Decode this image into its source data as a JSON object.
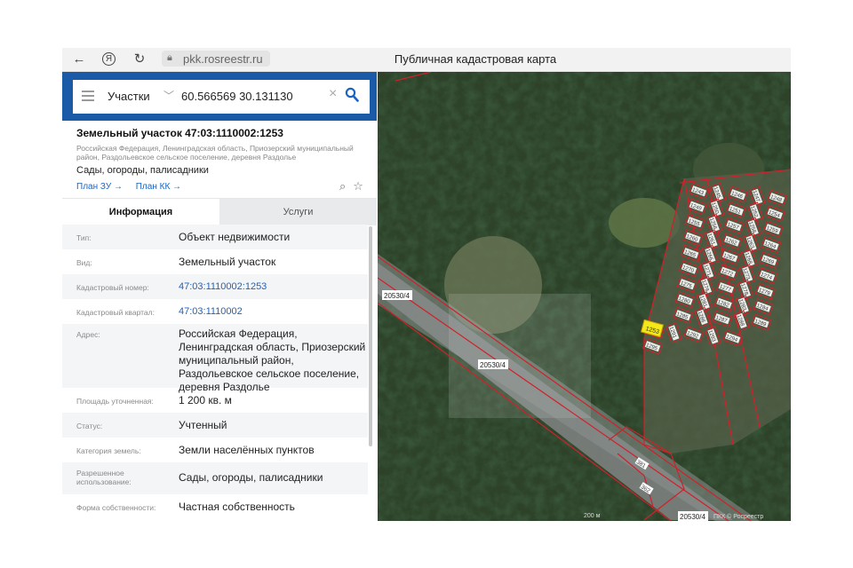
{
  "browser": {
    "url": "pkk.rosreestr.ru",
    "title": "Публичная кадастровая карта"
  },
  "search": {
    "type": "Участки",
    "query": "60.566569 30.131130"
  },
  "parcel": {
    "title": "Земельный участок 47:03:1110002:1253",
    "address_short": "Российская Федерация, Ленинградская область, Приозерский муниципальный район, Раздольевское сельское поселение, деревня Раздолье",
    "use": "Сады, огороды, палисадники",
    "link_plan_zu": "План ЗУ →",
    "link_plan_kk": "План КК →"
  },
  "tabs": [
    "Информация",
    "Услуги"
  ],
  "fields": [
    {
      "label": "Тип:",
      "value": "Объект недвижимости"
    },
    {
      "label": "Вид:",
      "value": "Земельный участок"
    },
    {
      "label": "Кадастровый номер:",
      "value": "47:03:1110002:1253",
      "link": true
    },
    {
      "label": "Кадастровый квартал:",
      "value": "47:03:1110002",
      "link": true
    },
    {
      "label": "Адрес:",
      "value": "Российская Федерация, Ленинградская область, Приозерский муниципальный район, Раздольевское сельское поселение, деревня Раздолье"
    },
    {
      "label": "Площадь уточненная:",
      "value": "1 200 кв. м"
    },
    {
      "label": "Статус:",
      "value": "Учтенный"
    },
    {
      "label": "Категория земель:",
      "value": "Земли населённых пунктов"
    },
    {
      "label": "Разрешенное использование:",
      "value": "Сады, огороды, палисадники"
    },
    {
      "label": "Форма собственности:",
      "value": "Частная собственность"
    }
  ],
  "map": {
    "road_labels": [
      "20530/4",
      "20530/4",
      "20530/4"
    ],
    "parcel_labels": [
      "1243",
      "1245",
      "1246",
      "1247",
      "1248",
      "1249",
      "1250",
      "1251",
      "1252",
      "1253",
      "1254",
      "1255",
      "1256",
      "1257",
      "1258",
      "1259",
      "1260",
      "1261",
      "1262",
      "1263",
      "1264",
      "1265",
      "1266",
      "1267",
      "1268",
      "1269",
      "1270",
      "1271",
      "1272",
      "1273",
      "1274",
      "1275",
      "1276",
      "1277",
      "1278",
      "1279",
      "1280",
      "1281",
      "1282",
      "1283",
      "1284",
      "1285",
      "1286",
      "1287",
      "1288",
      "1289",
      "1290",
      "1291",
      "1292",
      "1293",
      "1294",
      "1295",
      "381",
      "362"
    ],
    "highlight": "1253",
    "scale": "200 м",
    "attribution": "ПКК © Росреестр"
  },
  "colors": {
    "brand": "#1a5aa6",
    "link": "#1a63c2",
    "boundary": "#d2202a",
    "highlight": "#f2e81a"
  }
}
